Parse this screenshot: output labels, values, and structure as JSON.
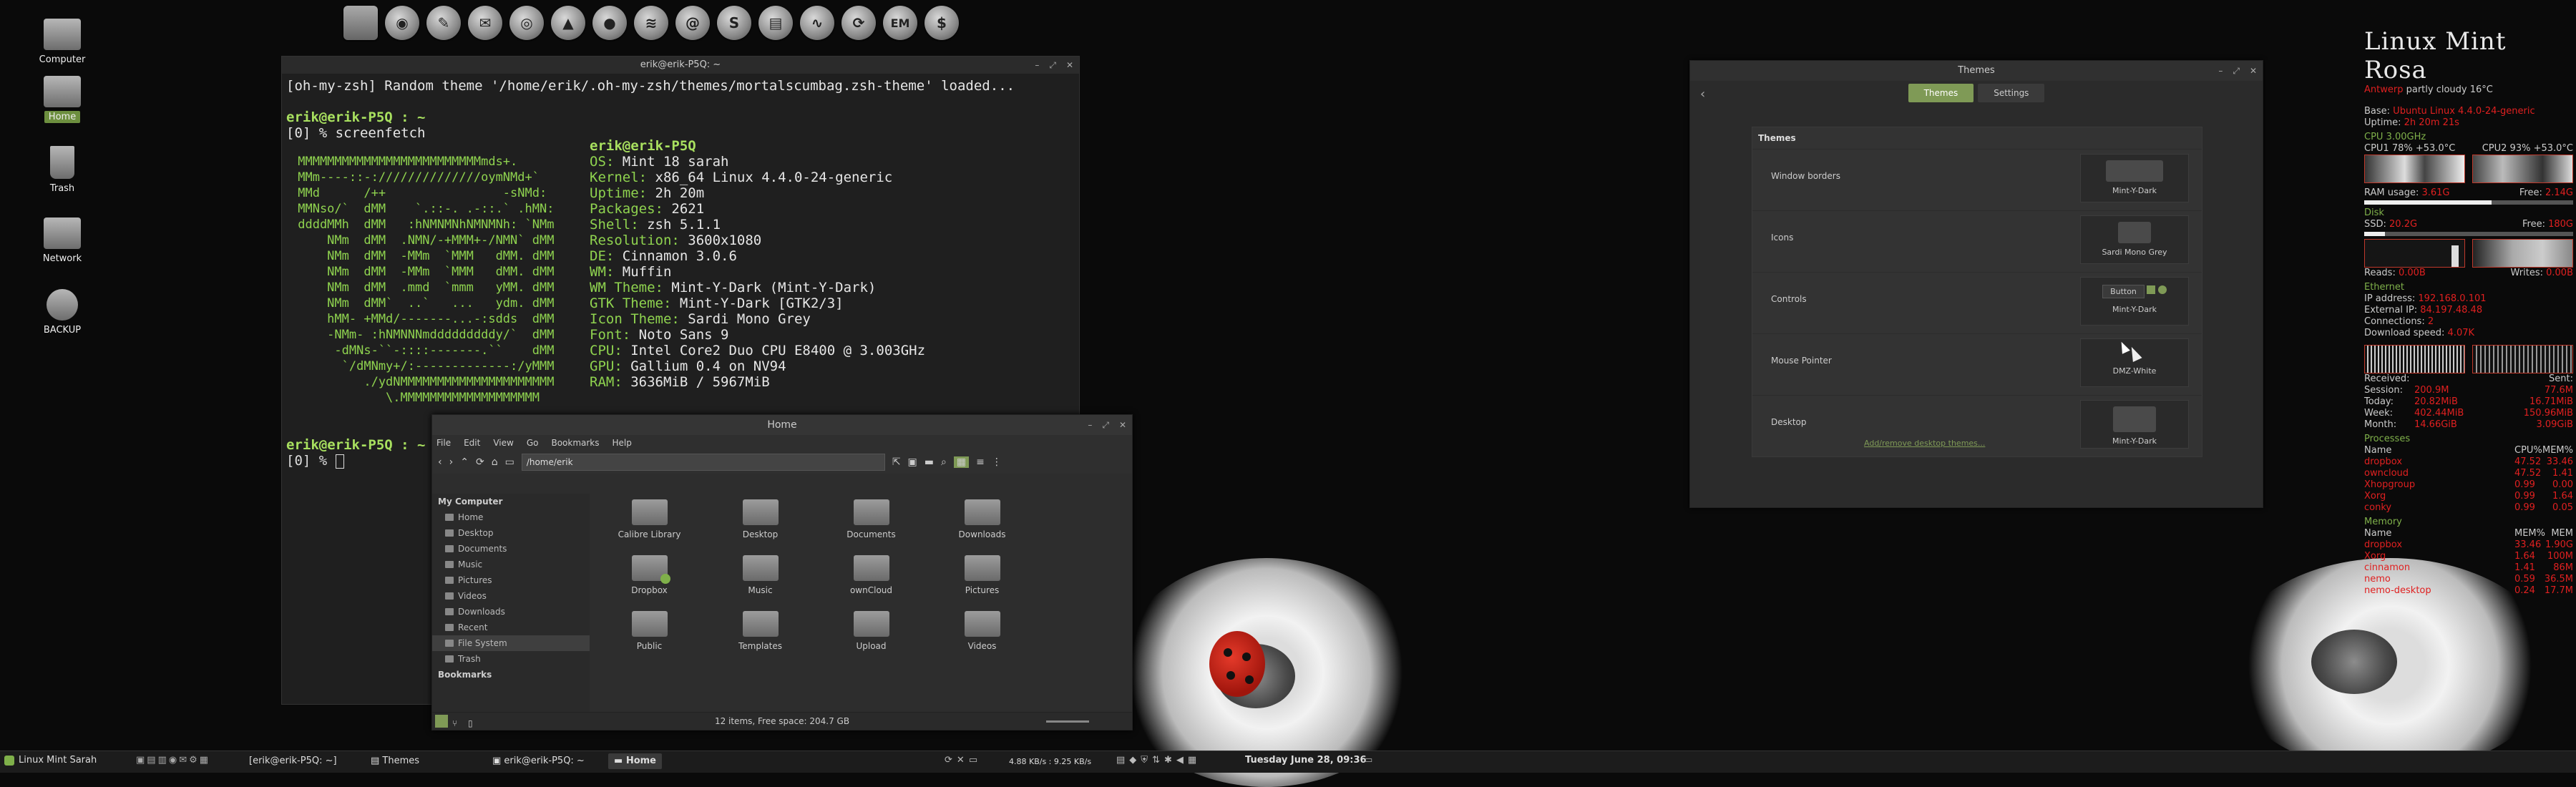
{
  "desktop": {
    "icons": [
      {
        "label": "Computer",
        "icon": "computer-icon"
      },
      {
        "label": "Home",
        "icon": "home-folder-icon",
        "selected": true
      },
      {
        "label": "Trash",
        "icon": "trash-icon"
      },
      {
        "label": "Network",
        "icon": "network-icon"
      },
      {
        "label": "BACKUP",
        "icon": "drive-icon"
      }
    ]
  },
  "dock": {
    "items": [
      "files-icon",
      "firefox-icon",
      "gimp-icon",
      "thunderbird-icon",
      "chrome-icon",
      "vlc-icon",
      "camera-icon",
      "spotify-icon",
      "email-icon",
      "shotwell-icon",
      "book-icon",
      "system-monitor-icon",
      "settings-icon",
      "em-icon",
      "calculator-icon"
    ]
  },
  "terminal": {
    "title": "erik@erik-P5Q: ~",
    "line1": "[oh-my-zsh] Random theme '/home/erik/.oh-my-zsh/themes/mortalscumbag.zsh-theme' loaded...",
    "prompt_user": "erik@erik-P5Q : ~",
    "prompt_cmd": "[0] % screenfetch",
    "user_host": "erik@erik-P5Q",
    "info": [
      {
        "k": "OS:",
        "v": " Mint 18 sarah"
      },
      {
        "k": "Kernel:",
        "v": " x86_64 Linux 4.4.0-24-generic"
      },
      {
        "k": "Uptime:",
        "v": " 2h 20m"
      },
      {
        "k": "Packages:",
        "v": " 2621"
      },
      {
        "k": "Shell:",
        "v": " zsh 5.1.1"
      },
      {
        "k": "Resolution:",
        "v": " 3600x1080"
      },
      {
        "k": "DE:",
        "v": " Cinnamon 3.0.6"
      },
      {
        "k": "WM:",
        "v": " Muffin"
      },
      {
        "k": "WM Theme:",
        "v": " Mint-Y-Dark (Mint-Y-Dark)"
      },
      {
        "k": "GTK Theme:",
        "v": " Mint-Y-Dark [GTK2/3]"
      },
      {
        "k": "Icon Theme:",
        "v": " Sardi Mono Grey"
      },
      {
        "k": "Font:",
        "v": " Noto Sans 9"
      },
      {
        "k": "CPU:",
        "v": " Intel Core2 Duo CPU E8400 @ 3.003GHz"
      },
      {
        "k": "GPU:",
        "v": " Gallium 0.4 on NV94"
      },
      {
        "k": "RAM:",
        "v": " 3636MiB / 5967MiB"
      }
    ],
    "prompt2_user": "erik@erik-P5Q : ~",
    "prompt2_cmd": "[0] % "
  },
  "files": {
    "title": "Home",
    "menu": [
      "File",
      "Edit",
      "View",
      "Go",
      "Bookmarks",
      "Help"
    ],
    "address": "/home/erik",
    "sidebar_header": "My Computer",
    "sidebar": [
      "Home",
      "Desktop",
      "Documents",
      "Music",
      "Pictures",
      "Videos",
      "Downloads",
      "Recent",
      "File System",
      "Trash"
    ],
    "bookmarks_header": "Bookmarks",
    "folders": [
      "Calibre Library",
      "Desktop",
      "Documents",
      "Downloads",
      "Dropbox",
      "Music",
      "ownCloud",
      "Pictures",
      "Public",
      "Templates",
      "Upload",
      "Videos"
    ],
    "status": "12 items, Free space: 204.7 GB"
  },
  "themes": {
    "title": "Themes",
    "tabs": [
      "Themes",
      "Settings"
    ],
    "panel_title": "Themes",
    "rows": [
      {
        "label": "Window borders",
        "value": "Mint-Y-Dark"
      },
      {
        "label": "Icons",
        "value": "Sardi Mono Grey"
      },
      {
        "label": "Controls",
        "value": "Mint-Y-Dark",
        "button": "Button"
      },
      {
        "label": "Mouse Pointer",
        "value": "DMZ-White"
      },
      {
        "label": "Desktop",
        "value": "Mint-Y-Dark"
      }
    ],
    "link": "Add/remove desktop themes..."
  },
  "conky": {
    "title": "Linux Mint Rosa",
    "weather_place": "Antwerp",
    "weather": " partly cloudy 16°C",
    "base_k": "Base:",
    "base_v": " Ubuntu Linux 4.4.0-24-generic",
    "uptime_k": "Uptime:",
    "uptime_v": " 2h 20m 21s",
    "cpu_freq": "CPU 3.00GHz",
    "cpu1": "CPU1 78% +53.0°C",
    "cpu2": "CPU2 93% +53.0°C",
    "ram_k": "RAM usage:",
    "ram_v": " 3.61G",
    "ram_free_k": "Free: ",
    "ram_free_v": "2.14G",
    "disk": "Disk",
    "ssd_k": "SSD:",
    "ssd_v": " 20.2G",
    "ssd_free_k": "Free: ",
    "ssd_free_v": "180G",
    "reads_k": "Reads:",
    "reads_v": " 0.00B",
    "writes_k": "Writes:",
    "writes_v": " 0.00B",
    "ethernet": "Ethernet",
    "ip_k": "IP address:",
    "ip_v": " 192.168.0.101",
    "ext_k": "External IP:",
    "ext_v": " 84.197.48.48",
    "conn_k": "Connections:",
    "conn_v": " 2",
    "dl_k": "Download speed:",
    "dl_v": " 4.07K",
    "received": "Received:",
    "sent": "Sent:",
    "net": [
      {
        "k": "Session:",
        "a": "200.9M",
        "b": "77.6M"
      },
      {
        "k": "Today:",
        "a": "20.82MiB",
        "b": "16.71MiB"
      },
      {
        "k": "Week:",
        "a": "402.44MiB",
        "b": "150.96MiB"
      },
      {
        "k": "Month:",
        "a": "14.66GiB",
        "b": "3.09GiB"
      }
    ],
    "processes": "Processes",
    "proc_head": [
      "Name",
      "CPU%",
      "MEM%"
    ],
    "procs": [
      {
        "n": "dropbox",
        "c": "47.52",
        "m": "33.46"
      },
      {
        "n": "owncloud",
        "c": "47.52",
        "m": "1.41"
      },
      {
        "n": "Xhopgroup",
        "c": "0.99",
        "m": "0.00"
      },
      {
        "n": "Xorg",
        "c": "0.99",
        "m": "1.64"
      },
      {
        "n": "conky",
        "c": "0.99",
        "m": "0.05"
      }
    ],
    "memory": "Memory",
    "mem_head": [
      "Name",
      "MEM%",
      "MEM"
    ],
    "mems": [
      {
        "n": "dropbox",
        "p": "33.46",
        "m": "1.90G"
      },
      {
        "n": "Xorg",
        "p": "1.64",
        "m": "100M"
      },
      {
        "n": "cinnamon",
        "p": "1.41",
        "m": "86M"
      },
      {
        "n": "nemo",
        "p": "0.59",
        "m": "36.5M"
      },
      {
        "n": "nemo-desktop",
        "p": "0.24",
        "m": "17.7M"
      }
    ]
  },
  "taskbar": {
    "menu": "Linux Mint Sarah",
    "tasks": [
      {
        "label": "[erik@erik-P5Q: ~]",
        "active": false
      },
      {
        "label": "Themes",
        "active": false
      },
      {
        "label": "erik@erik-P5Q: ~",
        "active": false
      },
      {
        "label": "Home",
        "active": true
      }
    ],
    "net_speed": "4.88 KB/s : 9.25 KB/s",
    "clock": "Tuesday June 28, 09:36"
  }
}
